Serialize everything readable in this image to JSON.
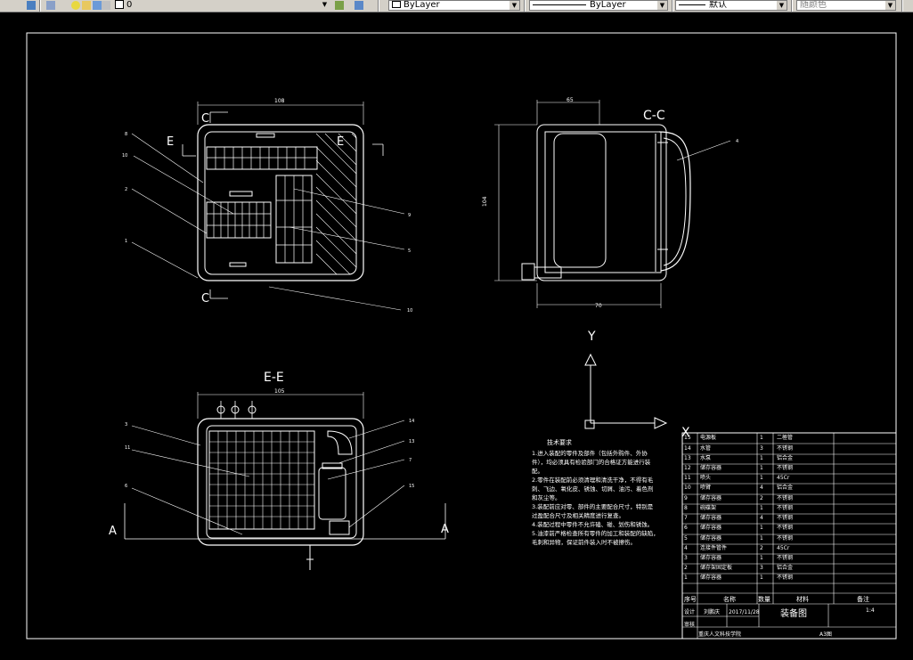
{
  "toolbar": {
    "layer_value": "0",
    "color_value": "ByLayer",
    "linetype_value": "ByLayer",
    "lineweight_value": "默认",
    "plotstyle_value": "随颜色"
  },
  "drawing": {
    "view_cc_label": "C-C",
    "view_ee_label": "E-E",
    "section_c": "C",
    "section_e": "E",
    "section_a": "A",
    "ucs_y": "Y",
    "ucs_x": "X",
    "dim_top_width": "108",
    "dim_cc_top": "65",
    "dim_cc_height": "104",
    "dim_cc_bottom": "70",
    "dim_ee_width": "105",
    "callouts_top": [
      "8",
      "10",
      "2",
      "1",
      "9",
      "5",
      "10",
      "4"
    ],
    "callouts_bottom": [
      "3",
      "11",
      "6",
      "14",
      "13",
      "7",
      "15"
    ]
  },
  "tech_notes": {
    "title": "技术要求",
    "lines": [
      "1.进入装配的零件及部件（包括外购件、外协",
      "件），均必须具有检验部门的合格证方能进行装",
      "配。",
      "2.零件在装配前必须清理和清洗干净，不得有毛",
      "刺、飞边、氧化皮、锈蚀、切屑、油污、着色剂",
      "和灰尘等。",
      "3.装配前应对零、部件的主要配合尺寸，特别是",
      "过盈配合尺寸及相关精度进行复查。",
      "4.装配过程中零件不允许磕、碰、划伤和锈蚀。",
      "5.油漆前严格检查所有零件的加工和装配的缺陷，",
      "毛刺和异物，保证前件装入时不被擦伤。"
    ]
  },
  "bom": {
    "rows": [
      {
        "no": "15",
        "name": "电源板",
        "qty": "1",
        "material": "二極管"
      },
      {
        "no": "14",
        "name": "水管",
        "qty": "3",
        "material": "不锈钢"
      },
      {
        "no": "13",
        "name": "水泵",
        "qty": "1",
        "material": "铝合金"
      },
      {
        "no": "12",
        "name": "储存容器",
        "qty": "1",
        "material": "不锈钢"
      },
      {
        "no": "11",
        "name": "喷头",
        "qty": "1",
        "material": "45Cr"
      },
      {
        "no": "10",
        "name": "喷臂",
        "qty": "4",
        "material": "铝合金"
      },
      {
        "no": "9",
        "name": "储存容器",
        "qty": "2",
        "material": "不锈钢"
      },
      {
        "no": "8",
        "name": "碗碟架",
        "qty": "1",
        "material": "不锈钢"
      },
      {
        "no": "7",
        "name": "储存容器",
        "qty": "4",
        "material": "不锈钢"
      },
      {
        "no": "6",
        "name": "储存容器",
        "qty": "1",
        "material": "不锈钢"
      },
      {
        "no": "5",
        "name": "储存容器",
        "qty": "1",
        "material": "不锈钢"
      },
      {
        "no": "4",
        "name": "连接件管件",
        "qty": "2",
        "material": "45Cr"
      },
      {
        "no": "3",
        "name": "储存容器",
        "qty": "1",
        "material": "不锈钢"
      },
      {
        "no": "2",
        "name": "储存架固定板",
        "qty": "3",
        "material": "铝合金"
      },
      {
        "no": "1",
        "name": "储存容器",
        "qty": "1",
        "material": "不锈钢"
      }
    ],
    "header": {
      "no": "序号",
      "name": "名称",
      "qty": "数量",
      "material": "材料",
      "remark": "备注"
    },
    "designer_label": "设计",
    "designer": "刘鹏庆",
    "date": "2017/11/28",
    "check_label": "审核",
    "drawing_title": "装备图",
    "scale": "1:4",
    "school": "重庆人文科技学院",
    "sheet_size": "A3图"
  },
  "colors": {
    "background": "#000000",
    "lines": "#ffffff",
    "toolbar": "#d4d0c8"
  }
}
